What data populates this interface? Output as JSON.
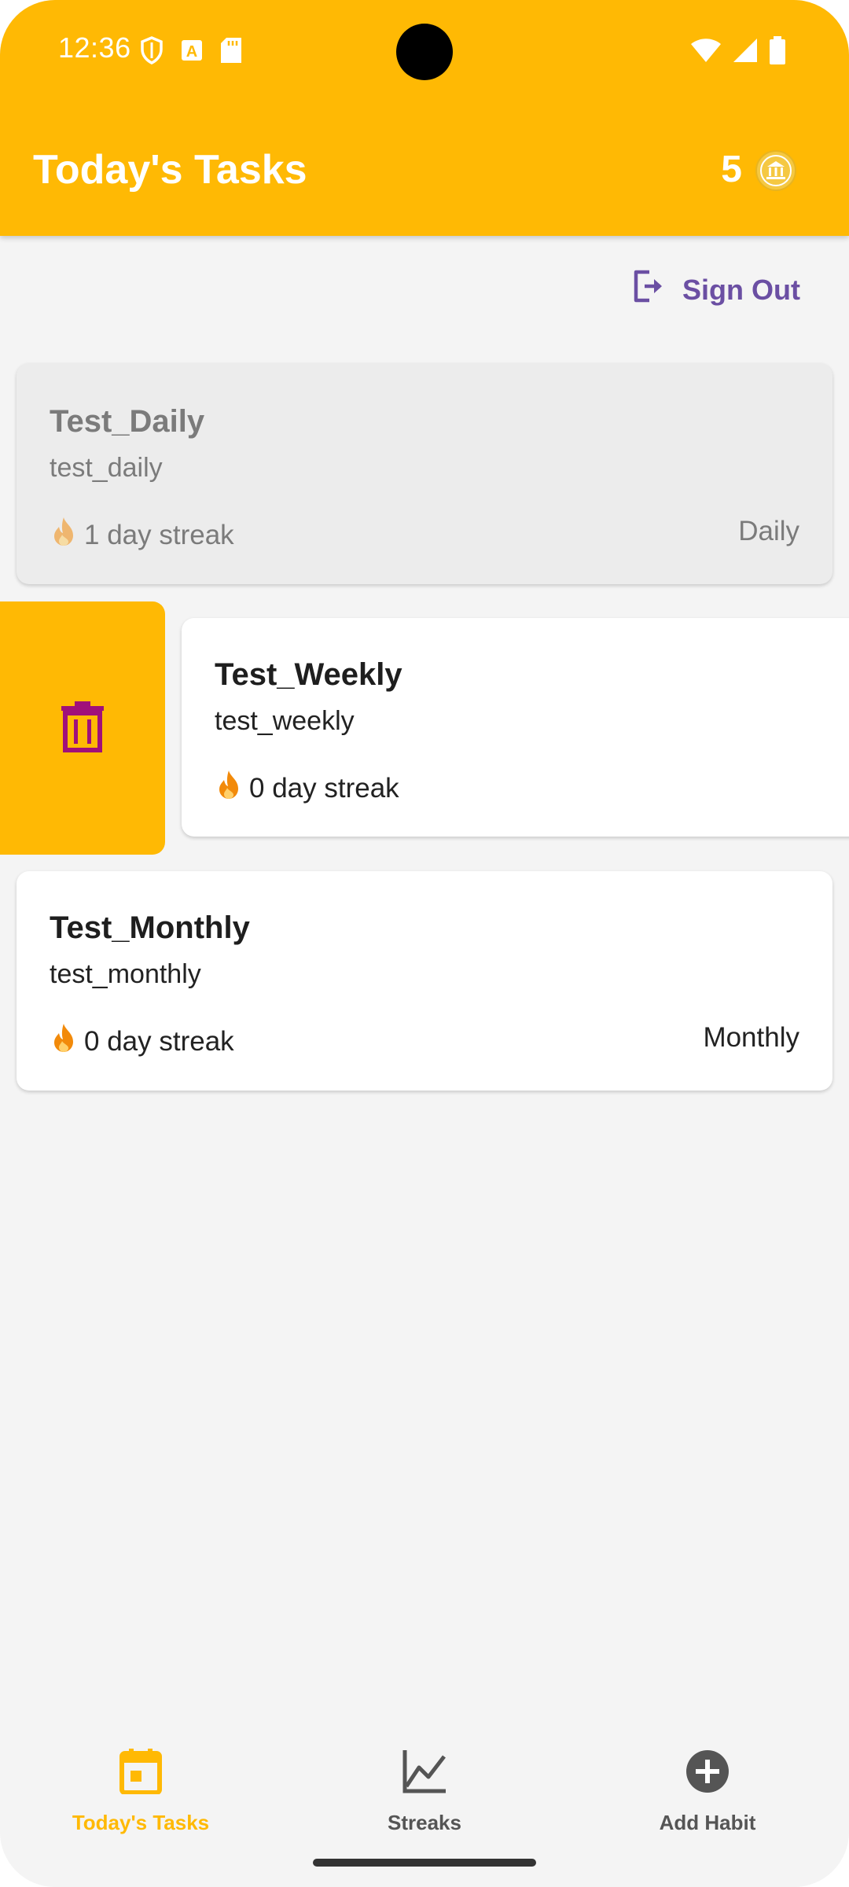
{
  "status_bar": {
    "time": "12:36",
    "left_icons": [
      "shield-icon",
      "font-a-icon",
      "sd-card-icon"
    ],
    "right_icons": [
      "wifi-icon",
      "cell-signal-icon",
      "battery-icon"
    ]
  },
  "app_bar": {
    "title": "Today's Tasks",
    "coin_count": "5",
    "coin_icon": "coin-icon"
  },
  "sign_out": {
    "label": "Sign Out",
    "icon": "logout-icon"
  },
  "tasks": [
    {
      "title": "Test_Daily",
      "description": "test_daily",
      "streak": "1 day streak",
      "frequency": "Daily",
      "completed": true
    },
    {
      "title": "Test_Weekly",
      "description": "test_weekly",
      "streak": "0 day streak",
      "frequency": "",
      "completed": false,
      "swiped": true
    },
    {
      "title": "Test_Monthly",
      "description": "test_monthly",
      "streak": "0 day streak",
      "frequency": "Monthly",
      "completed": false
    }
  ],
  "delete_action": {
    "icon": "trash-icon"
  },
  "bottom_nav": [
    {
      "label": "Today's Tasks",
      "icon": "calendar-icon",
      "active": true
    },
    {
      "label": "Streaks",
      "icon": "chart-line-icon",
      "active": false
    },
    {
      "label": "Add Habit",
      "icon": "add-circle-icon",
      "active": false
    }
  ],
  "colors": {
    "primary": "#FFB904",
    "accent": "#6B4FA3",
    "delete_icon": "#A0107A",
    "flame": "#F28A0A"
  }
}
